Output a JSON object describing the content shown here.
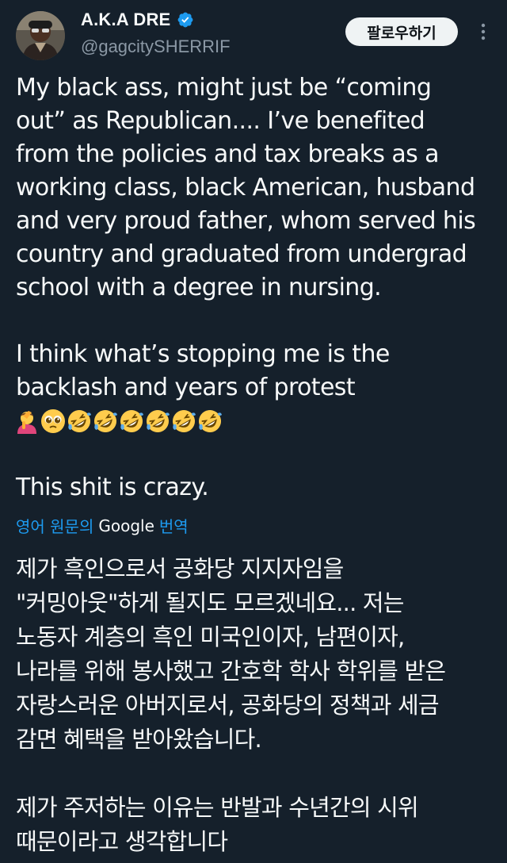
{
  "author": {
    "display_name": "A.K.A DRE",
    "handle": "@gagcitySHERRIF",
    "verified": true
  },
  "follow_button": {
    "label": "팔로우하기"
  },
  "more_menu": {
    "icon": "more-vertical-icon"
  },
  "tweet": {
    "paragraph_1": "My black ass, might just be “coming\nout” as Republican.... I’ve benefited\nfrom the policies and tax breaks as a\nworking class, black American, husband\nand very proud father, whom served his\ncountry and graduated from undergrad\nschool with a degree in nursing.",
    "paragraph_2": "I think what’s stopping me is the\nbacklash and years of protest",
    "emojis": [
      "person-facepalming",
      "pleading-face",
      "rolling-on-floor-laughing",
      "rolling-on-floor-laughing",
      "rolling-on-floor-laughing",
      "rolling-on-floor-laughing",
      "rolling-on-floor-laughing",
      "rolling-on-floor-laughing"
    ],
    "paragraph_3": "This shit is crazy."
  },
  "translate": {
    "prefix": "영어 원문의",
    "provider": "Google",
    "suffix": "번역"
  },
  "translation": {
    "paragraph_1": "제가 흑인으로서 공화당 지지자임을\n\"커밍아웃\"하게 될지도 모르겠네요... 저는\n노동자 계층의 흑인 미국인이자, 남편이자,\n나라를 위해 봉사했고 간호학 학사 학위를 받은\n자랑스러운 아버지로서, 공화당의 정책과 세금\n감면 혜택을 받아왔습니다.",
    "paragraph_2": "제가 주저하는 이유는 반발과 수년간의 시위\n때문이라고 생각합니다"
  },
  "colors": {
    "background": "#15202b",
    "text": "#f7f9f9",
    "secondary_text": "#8b98a5",
    "accent": "#1d9bf0",
    "follow_button_bg": "#eff3f4"
  }
}
